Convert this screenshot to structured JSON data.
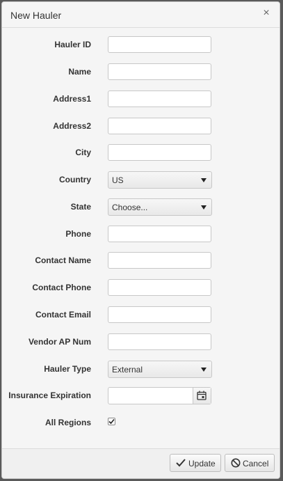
{
  "dialog": {
    "title": "New Hauler",
    "close_glyph": "×"
  },
  "fields": {
    "hauler_id": {
      "label": "Hauler ID",
      "value": ""
    },
    "name": {
      "label": "Name",
      "value": ""
    },
    "address1": {
      "label": "Address1",
      "value": ""
    },
    "address2": {
      "label": "Address2",
      "value": ""
    },
    "city": {
      "label": "City",
      "value": ""
    },
    "country": {
      "label": "Country",
      "selected": "US"
    },
    "state": {
      "label": "State",
      "selected": "Choose..."
    },
    "phone": {
      "label": "Phone",
      "value": ""
    },
    "contact_name": {
      "label": "Contact Name",
      "value": ""
    },
    "contact_phone": {
      "label": "Contact Phone",
      "value": ""
    },
    "contact_email": {
      "label": "Contact Email",
      "value": ""
    },
    "vendor_ap_num": {
      "label": "Vendor AP Num",
      "value": ""
    },
    "hauler_type": {
      "label": "Hauler Type",
      "selected": "External"
    },
    "insurance_expiration": {
      "label": "Insurance Expiration",
      "value": "",
      "icon": "calendar-icon"
    },
    "all_regions": {
      "label": "All Regions",
      "checked": true
    }
  },
  "footer": {
    "update_label": "Update",
    "update_icon": "checkmark-icon",
    "cancel_label": "Cancel",
    "cancel_icon": "ban-icon"
  }
}
